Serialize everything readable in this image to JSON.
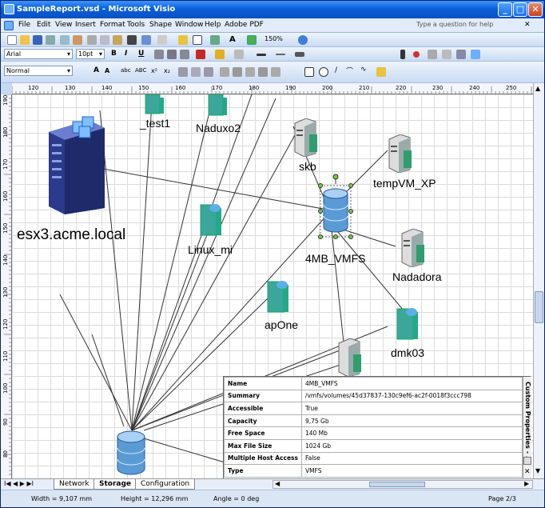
{
  "window": {
    "title": "SampleReport.vsd - Microsoft Visio",
    "min": "_",
    "max": "□",
    "close": "✕"
  },
  "menu": {
    "items": [
      "File",
      "Edit",
      "View",
      "Insert",
      "Format",
      "Tools",
      "Shape",
      "Window",
      "Help",
      "Adobe PDF"
    ],
    "help_placeholder": "Type a question for help"
  },
  "toolbar": {
    "zoom": "150%",
    "font": "Arial",
    "font_size": "10pt",
    "style": "Normal",
    "bold": "B",
    "italic": "I",
    "underline": "U"
  },
  "ruler": {
    "h_ticks": [
      "120",
      "130",
      "140",
      "150",
      "160",
      "170",
      "180",
      "190",
      "200",
      "210",
      "220",
      "230",
      "240",
      "250"
    ],
    "v_ticks": [
      "190",
      "180",
      "170",
      "160",
      "150",
      "140",
      "130",
      "120",
      "110",
      "100",
      "90",
      "80"
    ]
  },
  "diagram": {
    "labels": {
      "test1": "_test1",
      "naduxo2": "Naduxo2",
      "skb": "skb",
      "tempvm": "tempVM_XP",
      "esx": "esx3.acme.local",
      "linux": "Linux_mi",
      "vmfs": "4MB_VMFS",
      "nadadora": "Nadadora",
      "apone": "apOne",
      "dmk03": "dmk03"
    }
  },
  "properties": {
    "side_title": "Custom Properties - ...",
    "rows": [
      {
        "key": "Name",
        "value": "4MB_VMFS"
      },
      {
        "key": "Summary",
        "value": "/vmfs/volumes/45d37837-130c9ef6-ac2f-0018f3ccc798"
      },
      {
        "key": "Accessible",
        "value": "True"
      },
      {
        "key": "Capacity",
        "value": "9,75 Gb"
      },
      {
        "key": "Free Space",
        "value": "140 Mb"
      },
      {
        "key": "Max File Size",
        "value": "1024 Gb"
      },
      {
        "key": "Multiple Host Access",
        "value": "False"
      },
      {
        "key": "Type",
        "value": "VMFS"
      }
    ]
  },
  "tabs": {
    "items": [
      "Network",
      "Storage",
      "Configuration"
    ],
    "active": "Storage",
    "nav": "I◀ ◀ ▶ ▶I"
  },
  "status": {
    "width": "Width = 9,107 mm",
    "height": "Height = 12,296 mm",
    "angle": "Angle = 0 deg",
    "page": "Page 2/3"
  },
  "colors": {
    "server": "#3aa79a",
    "datastore": "#5b9bd5",
    "host": "#2b3a8a"
  }
}
